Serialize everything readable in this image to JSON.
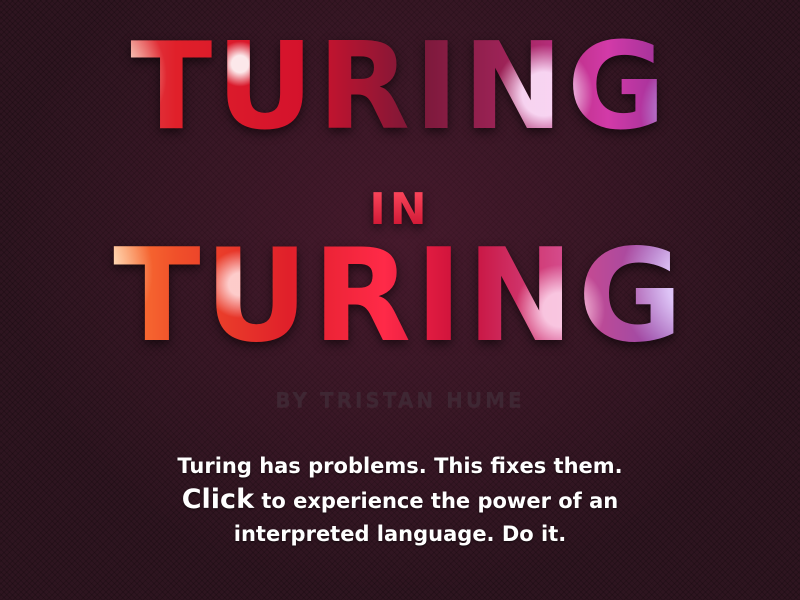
{
  "title": {
    "top": "TURING",
    "middle": "IN",
    "bottom": "TURING"
  },
  "byline": "BY TRISTAN HUME",
  "message": {
    "line1": "Turing has problems. This fixes them.",
    "click_word": "Click",
    "line2_rest": " to experience the power of an",
    "line3": "interpreted language. Do it."
  },
  "colors": {
    "background": "#2e1520",
    "text": "#ffffff",
    "byline": "#3e2733",
    "accent_red": "#e0202a",
    "accent_purple": "#8a5ac0"
  }
}
